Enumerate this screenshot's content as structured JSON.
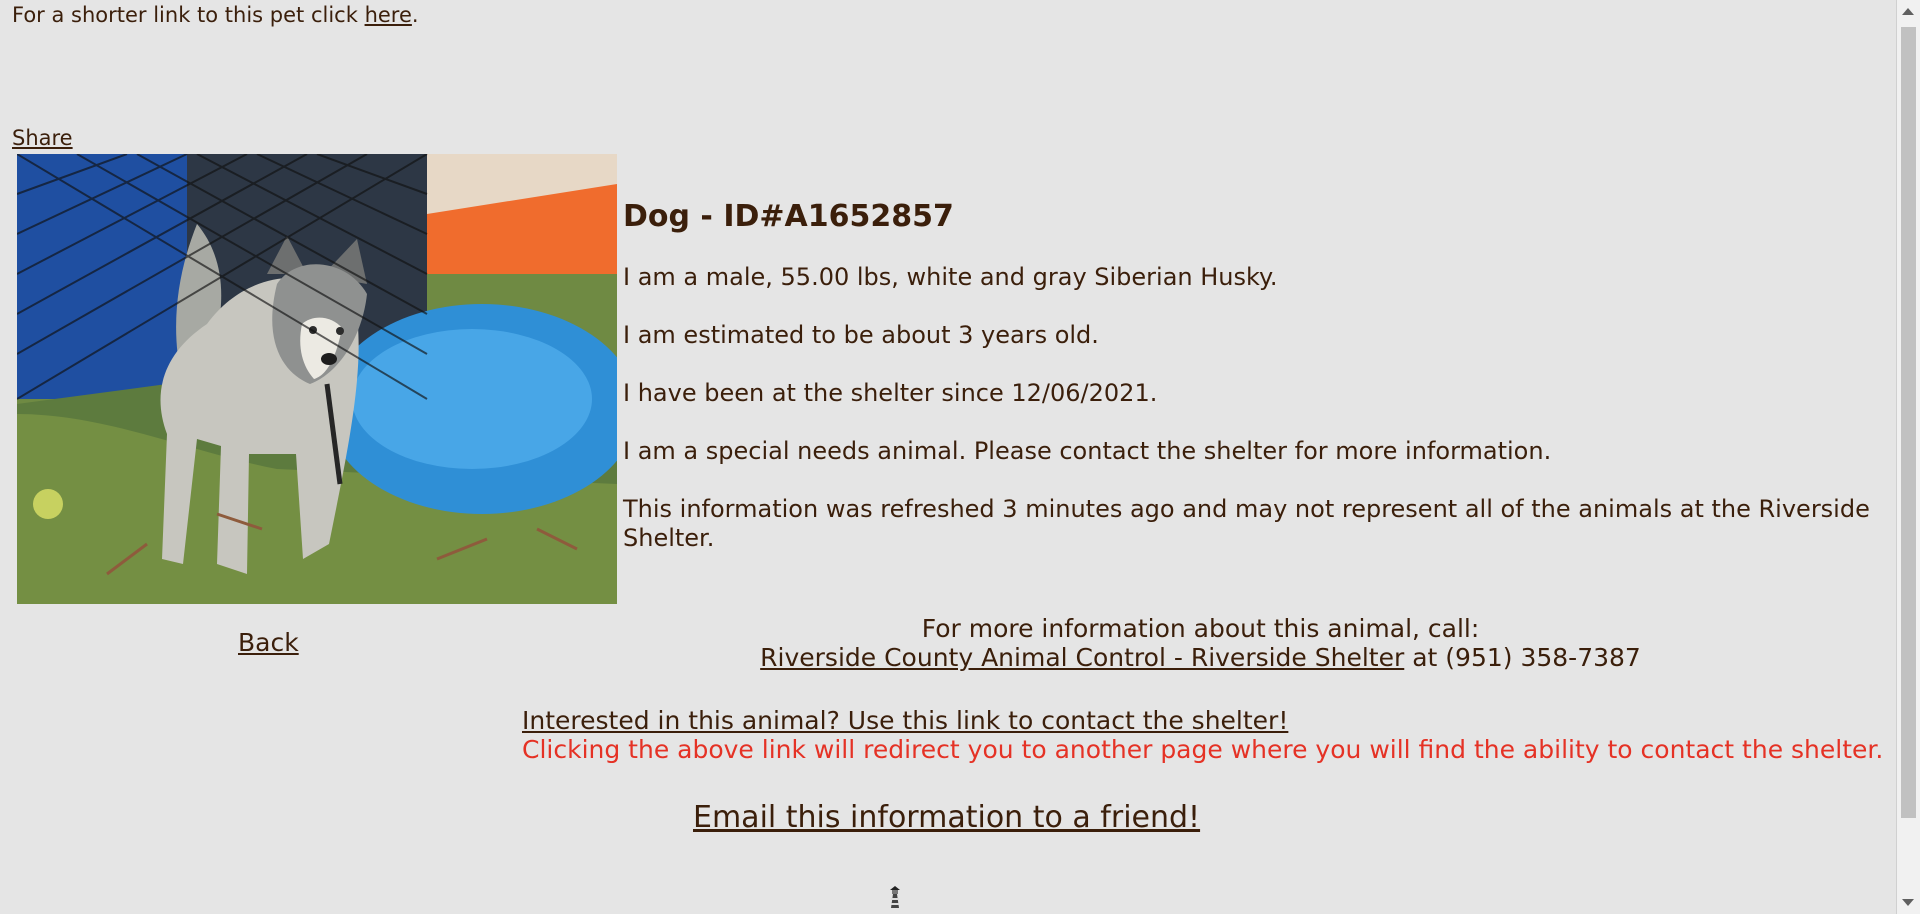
{
  "header": {
    "short_link_prefix": "For a shorter link to this pet click",
    "short_link_label": "here",
    "short_link_suffix": ".",
    "share_label": "Share"
  },
  "pet": {
    "title": "Dog - ID#A1652857",
    "description_1": "I am a male, 55.00 lbs, white and gray Siberian Husky.",
    "description_2": "I am estimated to be about 3 years old.",
    "description_3": "I have been at the shelter since 12/06/2021.",
    "description_4": "I am a special needs animal. Please contact the shelter for more information.",
    "refresh_notice": "This information was refreshed 3 minutes ago and may not represent all of the animals at the Riverside Shelter.",
    "photo_icon": "siberian-husky-photo"
  },
  "navigation": {
    "back_label": "Back"
  },
  "contact": {
    "call_prompt": "For more information about this animal, call:",
    "shelter_name": "Riverside County Animal Control - Riverside Shelter",
    "phone_prefix": "at",
    "phone": "(951) 358-7387",
    "interest_link": "Interested in this animal? Use this link to contact the shelter!",
    "redirect_warning": "Clicking the above link will redirect you to another page where you will find the ability to contact the shelter.",
    "email_link": "Email this information to a friend!"
  },
  "colors": {
    "background": "#e5e5e5",
    "text": "#3b1f0b",
    "warning": "#e53225"
  }
}
